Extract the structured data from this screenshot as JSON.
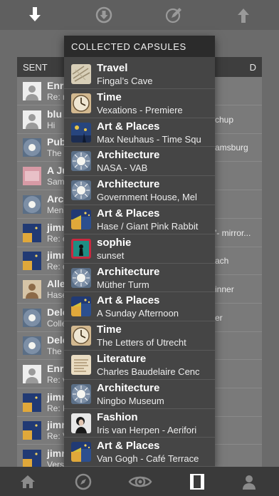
{
  "colors": {
    "accent": "#ffffff",
    "panel_bg": "#7a7a7a",
    "dropdown_bg": "#454545",
    "header_bg": "#2b2b2b"
  },
  "toolbar": {
    "icons": [
      "download-arrow-icon",
      "download-circle-icon",
      "compose-icon",
      "upload-arrow-icon"
    ]
  },
  "panel": {
    "tab_sent": "SENT",
    "tab_right": "D",
    "rows": [
      {
        "name": "Enr",
        "sub": "Re: r",
        "right": ""
      },
      {
        "name": "blu",
        "sub": "Hi",
        "right": "chup"
      },
      {
        "name": "Pub",
        "sub": "The",
        "right": "amsburg"
      },
      {
        "name": "A Ju",
        "sub": "Sam",
        "right": ""
      },
      {
        "name": "Arc",
        "sub": "Men",
        "right": ""
      },
      {
        "name": "jimr",
        "sub": "Re: c",
        "right": "'- mirror..."
      },
      {
        "name": "jimr",
        "sub": "Re: c",
        "right": "ach"
      },
      {
        "name": "Alle",
        "sub": "Hase",
        "right": "inner"
      },
      {
        "name": "Dele",
        "sub": "Colle",
        "right": "er"
      },
      {
        "name": "Dele",
        "sub": "The",
        "right": ""
      },
      {
        "name": "Enr",
        "sub": "Re: v",
        "right": ""
      },
      {
        "name": "jimr",
        "sub": "Re: F",
        "right": ""
      },
      {
        "name": "jimr",
        "sub": "Re: V",
        "right": ""
      },
      {
        "name": "jimr",
        "sub": "Vers",
        "right": ""
      }
    ]
  },
  "dropdown": {
    "title": "COLLECTED CAPSULES",
    "items": [
      {
        "category": "Travel",
        "title": "Fingal’s Cave",
        "thumb": "paper"
      },
      {
        "category": "Time",
        "title": "Vexations - Premiere",
        "thumb": "clock"
      },
      {
        "category": "Art & Places",
        "title": "Max Neuhaus - Time Squ",
        "thumb": "starry"
      },
      {
        "category": "Architecture",
        "title": "NASA - VAB",
        "thumb": "sun"
      },
      {
        "category": "Architecture",
        "title": "Government House, Mel",
        "thumb": "sun"
      },
      {
        "category": "Art & Places",
        "title": "Hase / Giant Pink Rabbit",
        "thumb": "cafe"
      },
      {
        "category": "sophie",
        "title": "sunset",
        "thumb": "sophie"
      },
      {
        "category": "Architecture",
        "title": "Müther Turm",
        "thumb": "sun"
      },
      {
        "category": "Art & Places",
        "title": "A Sunday Afternoon",
        "thumb": "cafe"
      },
      {
        "category": "Time",
        "title": "The Letters of Utrecht",
        "thumb": "clock"
      },
      {
        "category": "Literature",
        "title": "Charles Baudelaire Cenc",
        "thumb": "letter"
      },
      {
        "category": "Architecture",
        "title": "Ningbo Museum",
        "thumb": "sun"
      },
      {
        "category": "Fashion",
        "title": "Iris van Herpen - Aerifori",
        "thumb": "fashion"
      },
      {
        "category": "Art & Places",
        "title": "Van Gogh - Café Terrace",
        "thumb": "cafe"
      }
    ]
  },
  "tabbar": {
    "icons": [
      "home-icon",
      "compass-icon",
      "eye-icon",
      "capsules-icon",
      "profile-icon"
    ]
  }
}
